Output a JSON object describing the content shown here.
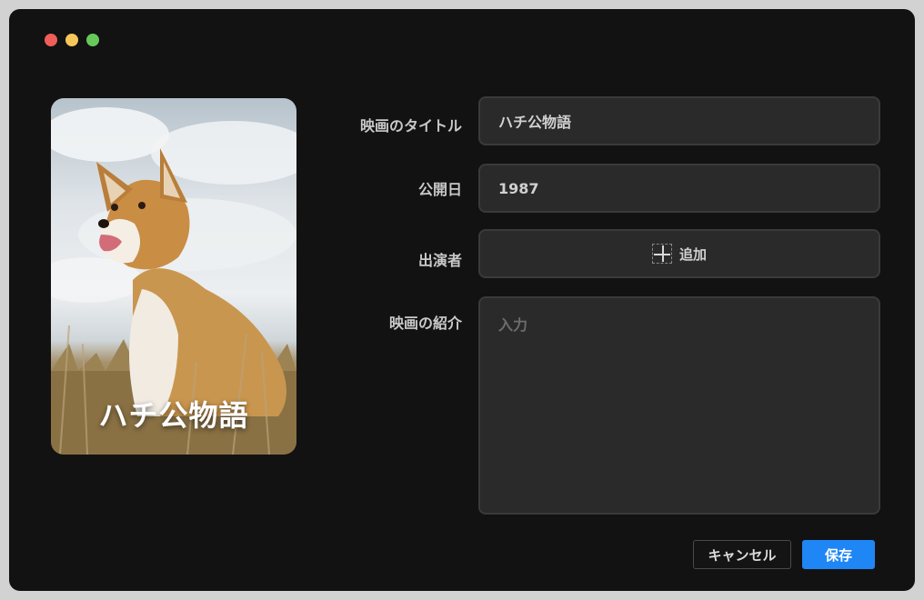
{
  "window": {
    "controls": [
      "close",
      "minimize",
      "maximize"
    ],
    "control_colors": {
      "close": "#ef5f58",
      "minimize": "#f7c65a",
      "maximize": "#67c85b"
    }
  },
  "poster": {
    "title": "ハチ公物語"
  },
  "form": {
    "title_label": "映画のタイトル",
    "title_value": "ハチ公物語",
    "date_label": "公開日",
    "date_value": "1987",
    "cast_label": "出演者",
    "cast_add_label": "追加",
    "intro_label": "映画の紹介",
    "intro_placeholder": "入力",
    "intro_value": ""
  },
  "actions": {
    "cancel_label": "キャンセル",
    "save_label": "保存",
    "save_color": "#1f86f5"
  }
}
